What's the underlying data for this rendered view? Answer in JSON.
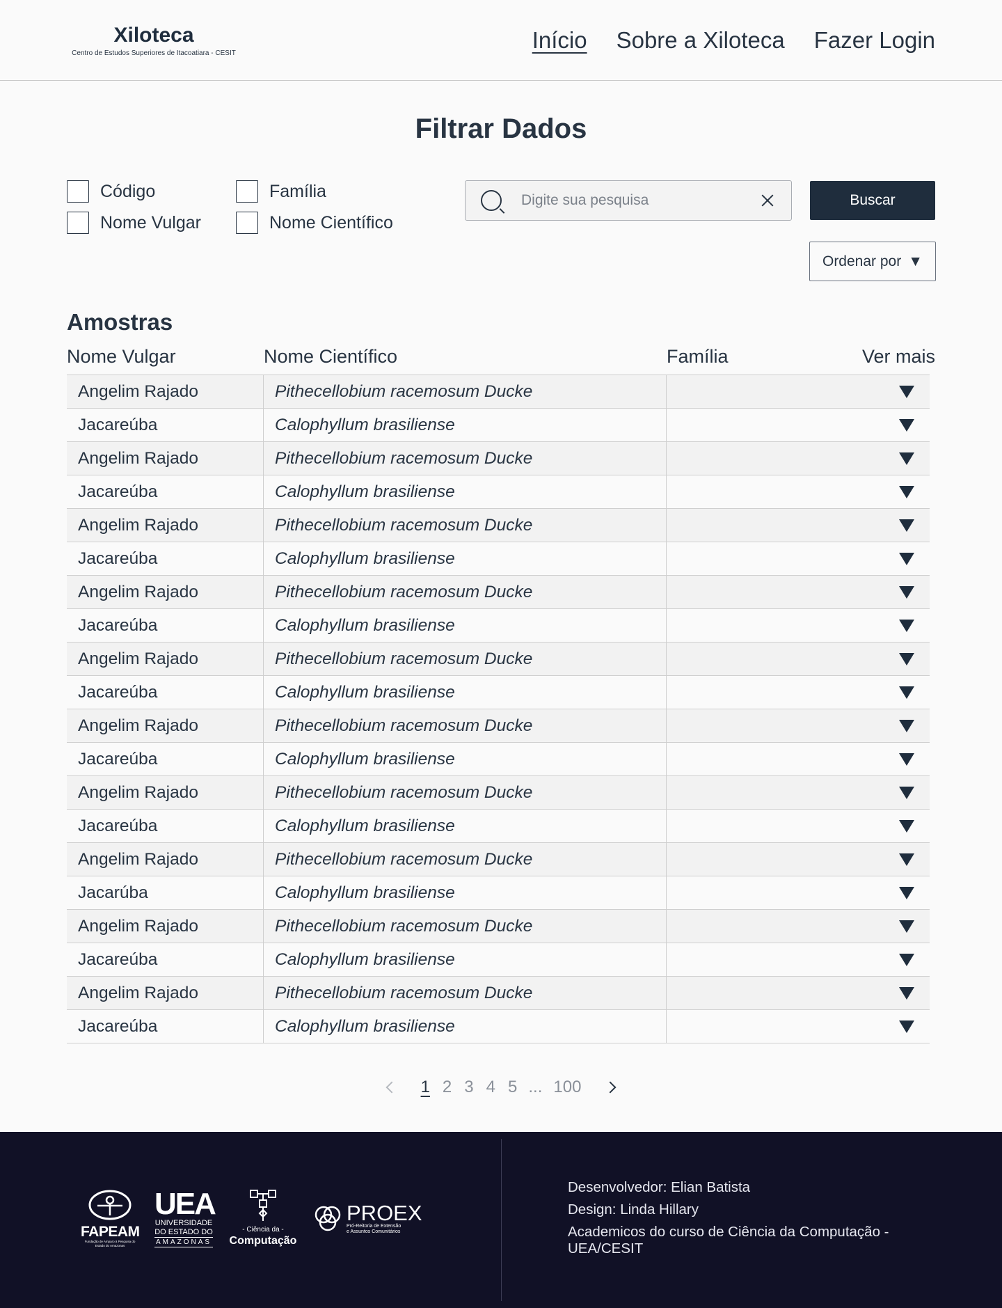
{
  "header": {
    "brand_title": "Xiloteca",
    "brand_subtitle": "Centro de Estudos Superiores de Itacoatiara - CESIT",
    "nav": [
      {
        "label": "Início",
        "active": true
      },
      {
        "label": "Sobre a Xiloteca",
        "active": false
      },
      {
        "label": "Fazer Login",
        "active": false
      }
    ]
  },
  "filter": {
    "title": "Filtrar Dados",
    "checkboxes": [
      {
        "label": "Código",
        "checked": false
      },
      {
        "label": "Família",
        "checked": false
      },
      {
        "label": "Nome Vulgar",
        "checked": false
      },
      {
        "label": "Nome Científico",
        "checked": false
      }
    ],
    "search_placeholder": "Digite sua pesquisa",
    "search_value": "",
    "search_button": "Buscar",
    "order_button": "Ordenar por",
    "order_arrow": "▼"
  },
  "table": {
    "title": "Amostras",
    "headers": [
      "Nome Vulgar",
      "Nome Científico",
      "Família",
      "Ver mais"
    ],
    "rows": [
      [
        "Angelim Rajado",
        "Pithecellobium racemosum Ducke",
        ""
      ],
      [
        "Jacareúba",
        "Calophyllum brasiliense",
        ""
      ],
      [
        "Angelim Rajado",
        "Pithecellobium racemosum Ducke",
        ""
      ],
      [
        "Jacareúba",
        "Calophyllum brasiliense",
        ""
      ],
      [
        "Angelim Rajado",
        "Pithecellobium racemosum Ducke",
        ""
      ],
      [
        "Jacareúba",
        "Calophyllum brasiliense",
        ""
      ],
      [
        "Angelim Rajado",
        "Pithecellobium racemosum Ducke",
        ""
      ],
      [
        "Jacareúba",
        "Calophyllum brasiliense",
        ""
      ],
      [
        "Angelim Rajado",
        "Pithecellobium racemosum Ducke",
        ""
      ],
      [
        "Jacareúba",
        "Calophyllum brasiliense",
        ""
      ],
      [
        "Angelim Rajado",
        "Pithecellobium racemosum Ducke",
        ""
      ],
      [
        "Jacareúba",
        "Calophyllum brasiliense",
        ""
      ],
      [
        "Angelim Rajado",
        "Pithecellobium racemosum Ducke",
        ""
      ],
      [
        "Jacareúba",
        "Calophyllum brasiliense",
        ""
      ],
      [
        "Angelim Rajado",
        "Pithecellobium racemosum Ducke",
        ""
      ],
      [
        "Jacarúba",
        "Calophyllum brasiliense",
        ""
      ],
      [
        "Angelim Rajado",
        "Pithecellobium racemosum Ducke",
        ""
      ],
      [
        "Jacareúba",
        "Calophyllum brasiliense",
        ""
      ],
      [
        "Angelim Rajado",
        "Pithecellobium racemosum Ducke",
        ""
      ],
      [
        "Jacareúba",
        "Calophyllum brasiliense",
        ""
      ]
    ]
  },
  "pagination": {
    "pages": [
      "1",
      "2",
      "3",
      "4",
      "5"
    ],
    "ellipsis": "...",
    "last": "100",
    "current": "1"
  },
  "footer": {
    "logos": {
      "fapeam": "FAPEAM",
      "fapeam_sub": "Fundação de Amparo à Pesquisa do Estado do Amazonas",
      "uea": "UEA",
      "uea_sub1": "UNIVERSIDADE",
      "uea_sub2": "DO ESTADO DO",
      "uea_sub3": "AMAZONAS",
      "cc_top": "- Ciência da -",
      "cc_main": "Computação",
      "proex": "PROEX",
      "proex_sub1": "Pró-Reitoria de Extensão",
      "proex_sub2": "e Assuntos Comunitários"
    },
    "credits": [
      "Desenvolvedor: Elian Batista",
      "Design: Linda Hillary",
      "Academicos do curso de Ciência da Computação - UEA/CESIT"
    ]
  },
  "colors": {
    "primary": "#1f2d3d",
    "text": "#283442",
    "background": "#fafafa",
    "row_alt": "#f2f2f2",
    "footer": "#111126"
  }
}
